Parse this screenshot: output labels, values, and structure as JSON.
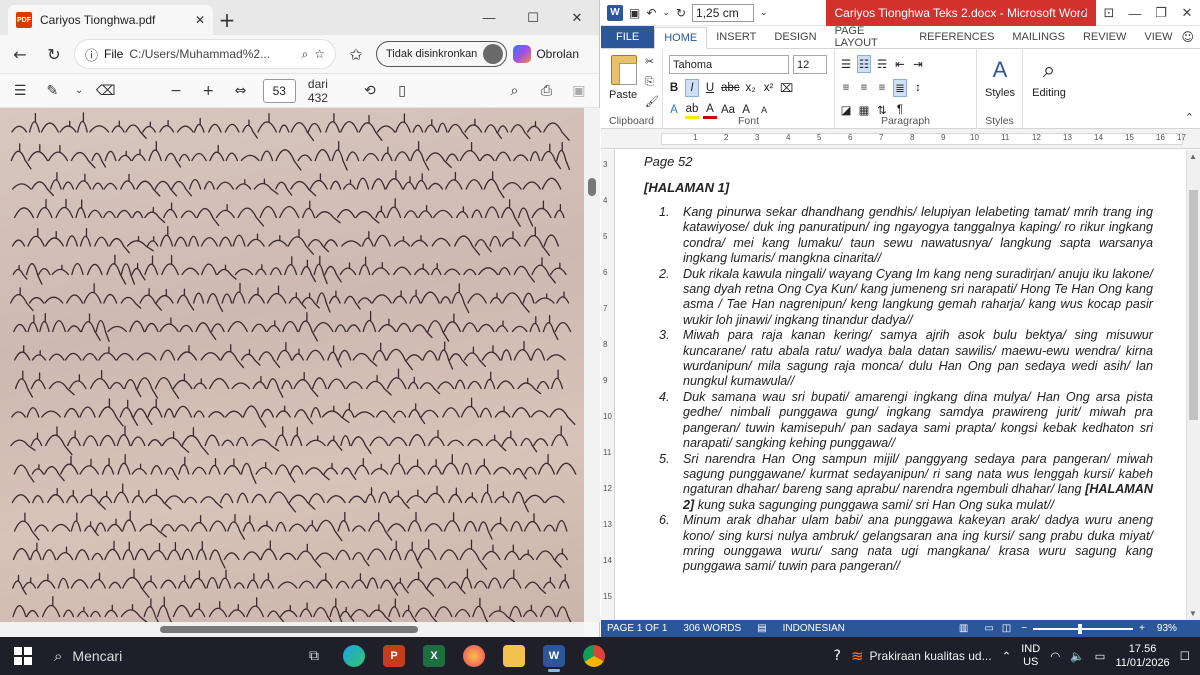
{
  "edge": {
    "tab_title": "Cariyos Tionghwa.pdf",
    "pdf_badge": "PDF",
    "address_label": "File",
    "url": "C:/Users/Muhammad%2...",
    "sync_label": "Tidak disinkronkan",
    "copilot_label": "Obrolan",
    "page_current": "53",
    "page_total": "dari 432"
  },
  "word": {
    "logo": "W",
    "line_spacing": "1,25 cm",
    "window_title": "Cariyos Tionghwa Teks 2.docx - Microsoft Word",
    "tabs": [
      "FILE",
      "HOME",
      "INSERT",
      "DESIGN",
      "PAGE LAYOUT",
      "REFERENCES",
      "MAILINGS",
      "REVIEW",
      "VIEW"
    ],
    "font_name": "Tahoma",
    "font_size": "12",
    "groups": {
      "clipboard": "Clipboard",
      "font": "Font",
      "paragraph": "Paragraph",
      "styles": "Styles"
    },
    "paste_label": "Paste",
    "styles_label": "Styles",
    "editing_label": "Editing",
    "doc": {
      "page_label": "Page 52",
      "halaman": "[HALAMAN 1]",
      "items": [
        {
          "num": "1.",
          "text": "Kang pinurwa sekar dhandhang gendhis/ lelupiyan lelabeting tamat/ mrih trang ing katawiyose/ duk ing panuratipun/ ing ngayogya tanggalnya kaping/ ro rikur ingkang condra/ mei kang lumaku/ taun sewu nawatusnya/ langkung sapta warsanya ingkang lumaris/ mangkna cinarita//"
        },
        {
          "num": "2.",
          "text": "Duk rikala kawula ningali/ wayang Cyang Im kang neng suradirjan/ anuju iku lakone/ sang dyah retna Ong Cya Kun/ kang jumeneng sri narapati/ Hong Te Han Ong kang asma / Tae Han nagrenipun/ keng langkung gemah raharja/ kang wus kocap pasir wukir loh jinawi/ ingkang tinandur dadya//"
        },
        {
          "num": "3.",
          "text": "Miwah para raja kanan kering/ samya ajrih asok bulu bektya/ sing misuwur kuncarane/ ratu abala ratu/ wadya bala datan sawilis/ maewu-ewu wendra/ kirna wurdanipun/ mila sagung raja monca/ dulu Han Ong pan sedaya wedi asih/ lan nungkul kumawula//"
        },
        {
          "num": "4.",
          "text": "Duk samana wau sri bupati/ amarengi ingkang dina mulya/ Han Ong arsa pista gedhe/ nimbali punggawa gung/ ingkang samdya prawireng jurit/ miwah pra pangeran/ tuwin kamisepuh/ pan sadaya sami prapta/ kongsi kebak kedhaton sri narapati/ sangking kehing punggawa//"
        },
        {
          "num": "5.",
          "text_before": "Sri narendra Han Ong sampun mijil/ panggyang sedaya para pangeran/ miwah sagung punggawane/ kurmat sedayanipun/ ri sang nata wus lenggah kursi/ kabeh ngaturan dhahar/ bareng sang aprabu/ narendra ngembuli dhahar/ lang ",
          "text_bold": "[HALAMAN 2]",
          "text_after": " kung suka sagunging punggawa sami/ sri Han Ong suka mulat//"
        },
        {
          "num": "6.",
          "text": "Minum arak dhahar ulam babi/ ana punggawa kakeyan arak/ dadya wuru aneng kono/ sing kursi nulya ambruk/ gelangsaran ana ing kursi/ sang prabu duka miyat/ mring ounggawa wuru/ sang nata ugi mangkana/ krasa wuru sagung kang punggawa sami/ tuwin para pangeran//"
        }
      ]
    },
    "status": {
      "page": "PAGE 1 OF 1",
      "words": "306 WORDS",
      "language": "INDONESIAN",
      "zoom": "93%",
      "zoom_fraction": 0.93
    }
  },
  "taskbar": {
    "search_label": "Mencari",
    "weather_label": "Prakiraan kualitas ud...",
    "lang_top": "IND",
    "lang_bottom": "US",
    "time": "17.56",
    "date": "11/01/2026"
  },
  "colors": {
    "word_blue": "#2b579a",
    "word_title_red": "#d2322d",
    "taskbar": "#1f1f2a",
    "manuscript": "#d3c1b8"
  }
}
